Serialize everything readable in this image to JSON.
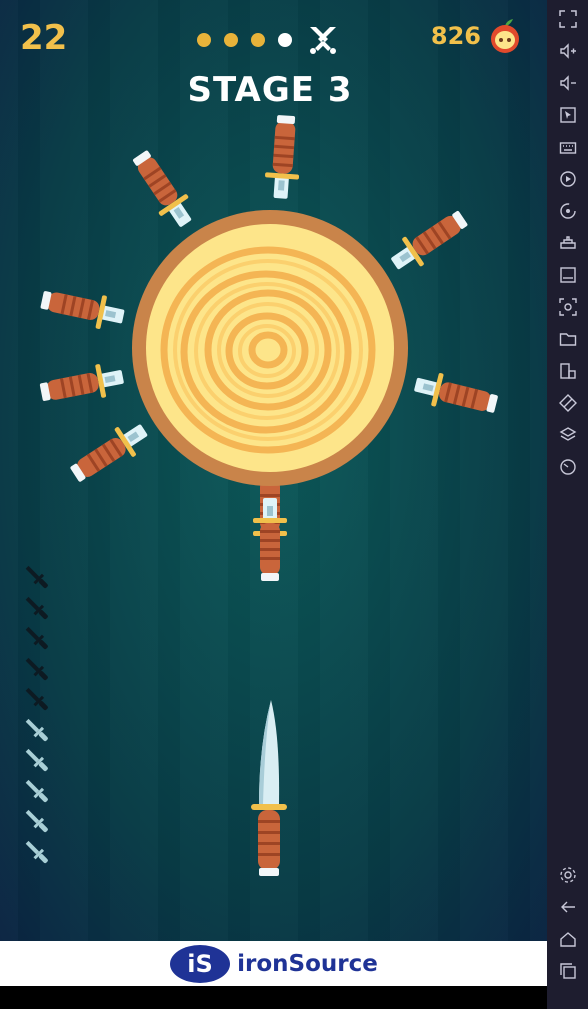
{
  "game": {
    "score": "22",
    "stage_title": "STAGE 3",
    "apples": "826",
    "stage_progress": {
      "total_dots": 4,
      "current_index": 3,
      "boss_icon": "crossed-swords-icon"
    },
    "knives_remaining": 5,
    "knives_total": 10
  },
  "ad": {
    "brand_text": "ironSource",
    "logo_text": "iS"
  },
  "colors": {
    "score": "#f1c04b",
    "dot": "#e8b33a",
    "bark": "#c9844a",
    "wood": "#fde58a",
    "ring": "#f4b554",
    "handle": "#c9653b",
    "sidebar": "#1e1d2f",
    "ad_brand": "#1f3396"
  },
  "sidebar": {
    "top_buttons": [
      "fullscreen-icon",
      "volume-up-icon",
      "volume-down-icon",
      "cursor-icon",
      "keyboard-icon",
      "record-icon",
      "rotate-icon",
      "gamepad-icon",
      "apk-icon",
      "screenshot-icon",
      "folder-icon",
      "resize-icon",
      "erase-icon",
      "layers-icon",
      "speed-icon"
    ],
    "bottom_buttons": [
      "settings-icon",
      "back-icon",
      "home-icon",
      "recents-icon"
    ]
  }
}
